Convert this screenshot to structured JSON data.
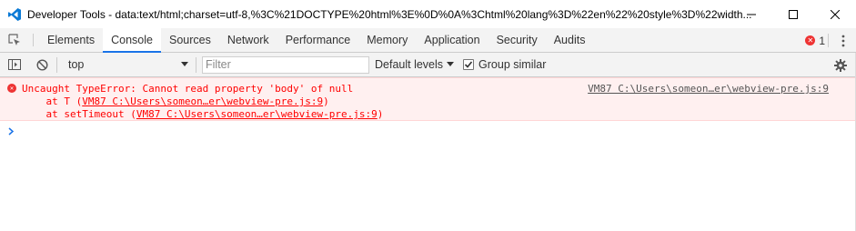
{
  "window": {
    "title": "Developer Tools - data:text/html;charset=utf-8,%3C%21DOCTYPE%20html%3E%0D%0A%3Chtml%20lang%3D%22en%22%20style%3D%22width..."
  },
  "tabs": [
    {
      "label": "Elements"
    },
    {
      "label": "Console"
    },
    {
      "label": "Sources"
    },
    {
      "label": "Network"
    },
    {
      "label": "Performance"
    },
    {
      "label": "Memory"
    },
    {
      "label": "Application"
    },
    {
      "label": "Security"
    },
    {
      "label": "Audits"
    }
  ],
  "active_tab": "Console",
  "error_count": "1",
  "toolbar": {
    "context": "top",
    "filter_placeholder": "Filter",
    "levels_label": "Default levels",
    "group_similar_label": "Group similar",
    "group_similar_checked": true
  },
  "messages": [
    {
      "type": "error",
      "text": "Uncaught TypeError: Cannot read property 'body' of null",
      "source": "VM87 C:\\Users\\someon…er\\webview-pre.js:9",
      "stack": [
        {
          "prefix": "    at T (",
          "link": "VM87 C:\\Users\\someon…er\\webview-pre.js:9",
          "suffix": ")"
        },
        {
          "prefix": "    at setTimeout (",
          "link": "VM87 C:\\Users\\someon…er\\webview-pre.js:9",
          "suffix": ")"
        }
      ]
    }
  ],
  "colors": {
    "accent": "#1a73e8",
    "error_text": "#ff0000",
    "error_bg": "#fff0f0",
    "toolbar_bg": "#f3f3f3"
  },
  "icons": {
    "app": "vscode-icon",
    "inspect": "inspect-element-icon",
    "sidebar": "console-sidebar-icon",
    "clear": "clear-console-icon",
    "settings": "gear-icon",
    "more": "more-vertical-icon"
  }
}
